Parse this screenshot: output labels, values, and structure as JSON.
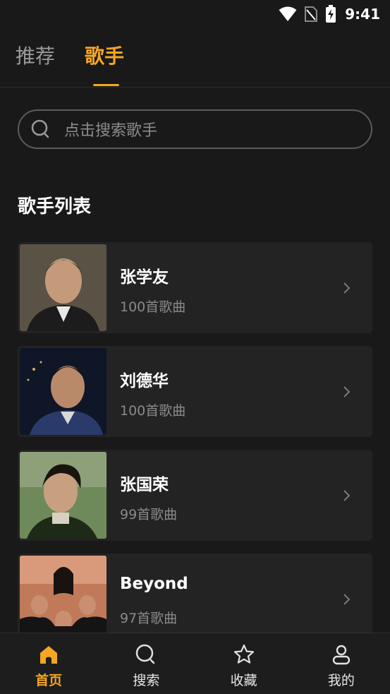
{
  "status_bar": {
    "time": "9:41",
    "icons": [
      "wifi-icon",
      "no-sim-icon",
      "battery-charging-icon"
    ]
  },
  "top_tabs": [
    {
      "label": "推荐",
      "active": false
    },
    {
      "label": "歌手",
      "active": true
    }
  ],
  "search": {
    "placeholder": "点击搜索歌手",
    "icon": "search-icon"
  },
  "section": {
    "title": "歌手列表"
  },
  "singers": [
    {
      "name": "张学友",
      "count": "100首歌曲",
      "avatar_color": "#5a4a3c"
    },
    {
      "name": "刘德华",
      "count": "100首歌曲",
      "avatar_color": "#1a2540"
    },
    {
      "name": "张国荣",
      "count": "99首歌曲",
      "avatar_color": "#3a5a3a"
    },
    {
      "name": "Beyond",
      "count": "97首歌曲",
      "avatar_color": "#8a4a3a"
    }
  ],
  "bottom_nav": [
    {
      "label": "首页",
      "icon": "home-icon",
      "active": true
    },
    {
      "label": "搜索",
      "icon": "search-icon",
      "active": false
    },
    {
      "label": "收藏",
      "icon": "star-icon",
      "active": false
    },
    {
      "label": "我的",
      "icon": "user-icon",
      "active": false
    }
  ],
  "colors": {
    "accent": "#f5a623",
    "background": "#191919",
    "card": "#232323",
    "muted_text": "#8a8a8a"
  }
}
